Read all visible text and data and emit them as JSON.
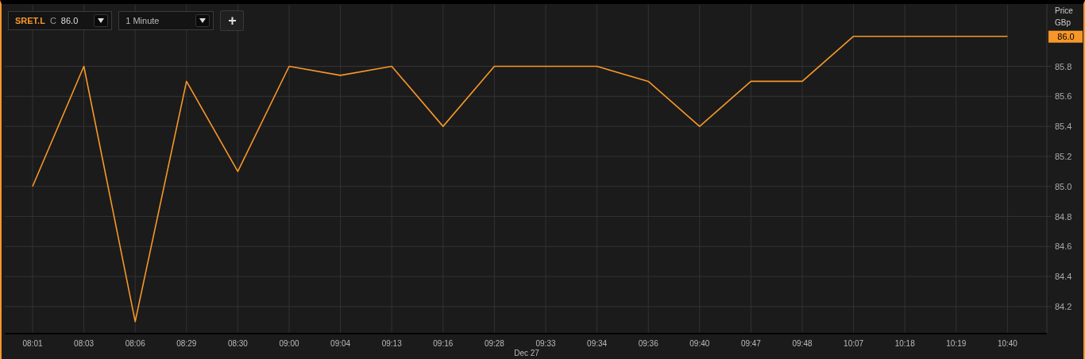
{
  "toolbar": {
    "close_label": "C",
    "close_value": "86.0",
    "interval": "1 Minute",
    "add_button": "+"
  },
  "price_axis": {
    "title_line1": "Price",
    "title_line2": "GBp",
    "last_value": "86.0"
  },
  "date_label": "Dec 27",
  "chart_data": {
    "type": "line",
    "categories": [
      "08:01",
      "08:03",
      "08:06",
      "08:29",
      "08:30",
      "09:00",
      "09:04",
      "09:13",
      "09:16",
      "09:28",
      "09:33",
      "09:34",
      "09:36",
      "09:40",
      "09:47",
      "09:48",
      "10:07",
      "10:18",
      "10:19",
      "10:40"
    ],
    "series": [
      {
        "name": "SRET.L",
        "color": "#f7972a",
        "values": [
          85.0,
          85.8,
          84.1,
          85.7,
          85.1,
          85.8,
          85.74,
          85.8,
          85.4,
          85.8,
          85.8,
          85.8,
          85.7,
          85.4,
          85.7,
          85.7,
          86.0,
          86.0,
          86.0,
          86.0
        ]
      }
    ],
    "grid": true,
    "ylim": [
      84.02,
      86.21
    ],
    "yticks": [
      {
        "value": 84.2,
        "label": "84.2"
      },
      {
        "value": 84.4,
        "label": "84.4"
      },
      {
        "value": 84.6,
        "label": "84.6"
      },
      {
        "value": 84.8,
        "label": "84.8"
      },
      {
        "value": 85.0,
        "label": "85.0"
      },
      {
        "value": 85.2,
        "label": "85.2"
      },
      {
        "value": 85.4,
        "label": "85.4"
      },
      {
        "value": 85.6,
        "label": "85.6"
      },
      {
        "value": 85.8,
        "label": "85.8"
      }
    ]
  }
}
